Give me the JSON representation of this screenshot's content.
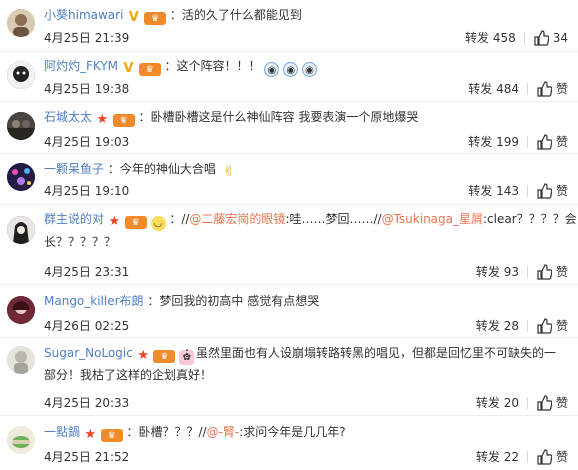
{
  "comments": [
    {
      "name": "小葵himawari",
      "text": "：活的久了什么都能见到",
      "date": "4月25日 21:39",
      "repost_label": "转发",
      "repost_count": "458",
      "like_text": "34",
      "avatar_color": "#cbb89e"
    },
    {
      "name": "阿灼灼_FKYM",
      "text": "：这个阵容！！！",
      "date": "4月25日 19:38",
      "repost_label": "转发",
      "repost_count": "484",
      "like_text": "赞",
      "avatar_color": "#444444"
    },
    {
      "name": "石城太太",
      "text": "：卧槽卧槽这是什么神仙阵容 我要表演一个原地爆哭",
      "date": "4月25日 19:03",
      "repost_label": "转发",
      "repost_count": "199",
      "like_text": "赞",
      "avatar_color": "#3e3a36"
    },
    {
      "name": "一颗呆鱼子",
      "text": "：今年的神仙大合唱",
      "date": "4月25日 19:10",
      "repost_label": "转发",
      "repost_count": "143",
      "like_text": "赞",
      "avatar_color": "#3a2a60"
    },
    {
      "name": "群主说的对",
      "text_prefix": "：//",
      "mention1": "@二藤宏崗的眼镜",
      "text_mid": ":哇……梦回……//",
      "mention2": "@Tsukinaga_星屑",
      "text_suffix": ":clear？？？？会",
      "text_line2": "长？？？？？",
      "date": "4月25日 23:31",
      "repost_label": "转发",
      "repost_count": "93",
      "like_text": "赞",
      "avatar_color": "#2b2b2b"
    },
    {
      "name": "Mango_killer布朗",
      "text": "：梦回我的初高中 感觉有点想哭",
      "date": "4月26日 02:25",
      "repost_label": "转发",
      "repost_count": "28",
      "like_text": "赞",
      "avatar_color": "#8a3a4a"
    },
    {
      "name": "Sugar_NoLogic",
      "text": "：虽然里面也有人设崩塌转路转黑的唱见，但都是回忆里不可缺失的一部分！我枯了这样的企划真好！",
      "date": "4月25日 20:33",
      "repost_label": "转发",
      "repost_count": "20",
      "like_text": "赞",
      "avatar_color": "#d7d7cf"
    },
    {
      "name": "一點鍋",
      "text_prefix": "：卧槽？？？//",
      "mention1": "@-腎-",
      "text_suffix": ":求问今年是几几年?",
      "date": "4月25日 21:52",
      "repost_label": "转发",
      "repost_count": "22",
      "like_text": "赞",
      "avatar_color": "#e6e2c8"
    }
  ]
}
